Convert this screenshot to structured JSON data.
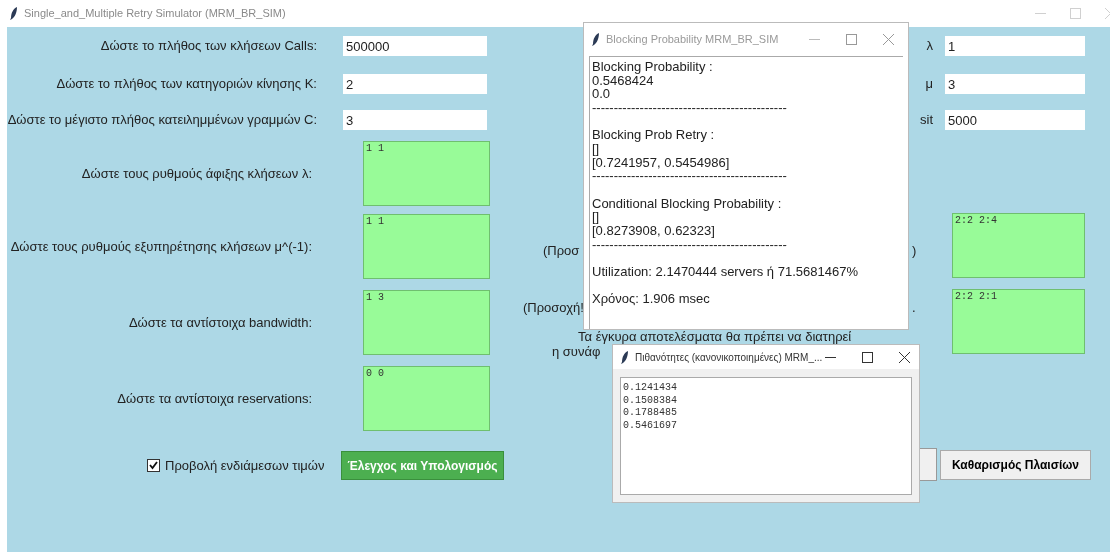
{
  "main_window": {
    "title": "Single_and_Multiple Retry Simulator (MRM_BR_SIM)",
    "fields": [
      {
        "kind": "entry",
        "label": "Δώστε το πλήθος των κλήσεων Calls:",
        "value": "500000"
      },
      {
        "kind": "entry",
        "label": "Δώστε το πλήθος των κατηγοριών κίνησης K:",
        "value": "2"
      },
      {
        "kind": "entry",
        "label": "Δώστε το μέγιστο πλήθος κατειλημμένων γραμμών C:",
        "value": "3"
      },
      {
        "kind": "textarea",
        "label": "Δώστε τους ρυθμούς άφιξης κλήσεων λ:",
        "value": "1 1"
      },
      {
        "kind": "textarea",
        "label": "Δώστε τους ρυθμούς εξυπηρέτησης κλήσεων μ^(-1):",
        "value": "1 1"
      },
      {
        "kind": "textarea",
        "label": "Δώστε τα αντίστοιχα bandwidth:",
        "value": "1 3"
      },
      {
        "kind": "textarea",
        "label": "Δώστε τα αντίστοιχα reservations:",
        "value": "0 0"
      }
    ],
    "checkbox": {
      "label": "Προβολή ενδιάμεσων τιμών",
      "checked": true
    },
    "compute_button": "Έλεγχος και Υπολογισμός",
    "right_fields": [
      {
        "label": "λ",
        "value": "1"
      },
      {
        "label": "μ",
        "value": "3"
      },
      {
        "label": "sit",
        "value": "5000"
      }
    ],
    "right_textareas": [
      "2:2 2:4",
      "2:2 2:1"
    ],
    "notes": [
      "(Προσ",
      ")",
      "(Προσοχή!",
      ".",
      "Τα έγκυρα αποτελέσματα θα πρέπει να διατηρεί",
      "η συνάφ"
    ],
    "clear_button": "Καθαρισμός Πλαισίων"
  },
  "blocking_window": {
    "title": "Blocking Probability MRM_BR_SIM",
    "blocks": [
      [
        "Blocking Probability :",
        "0.5468424",
        "0.0",
        "---------------------------------------------"
      ],
      [
        "Blocking Prob Retry :",
        "[]",
        "[0.7241957, 0.5454986]",
        "---------------------------------------------"
      ],
      [
        "Conditional Blocking Probability :",
        "[]",
        "[0.8273908, 0.62323]",
        "---------------------------------------------"
      ],
      [
        "Utilization: 2.1470444 servers ή 71.5681467%"
      ],
      [
        "Χρόνος: 1.906 msec"
      ]
    ]
  },
  "probabilities_window": {
    "title": "Πιθανότητες (κανονικοποιημένες) MRM_...",
    "lines": [
      "0.1241434",
      "0.1508384",
      "0.1788485",
      "0.5461697"
    ]
  }
}
